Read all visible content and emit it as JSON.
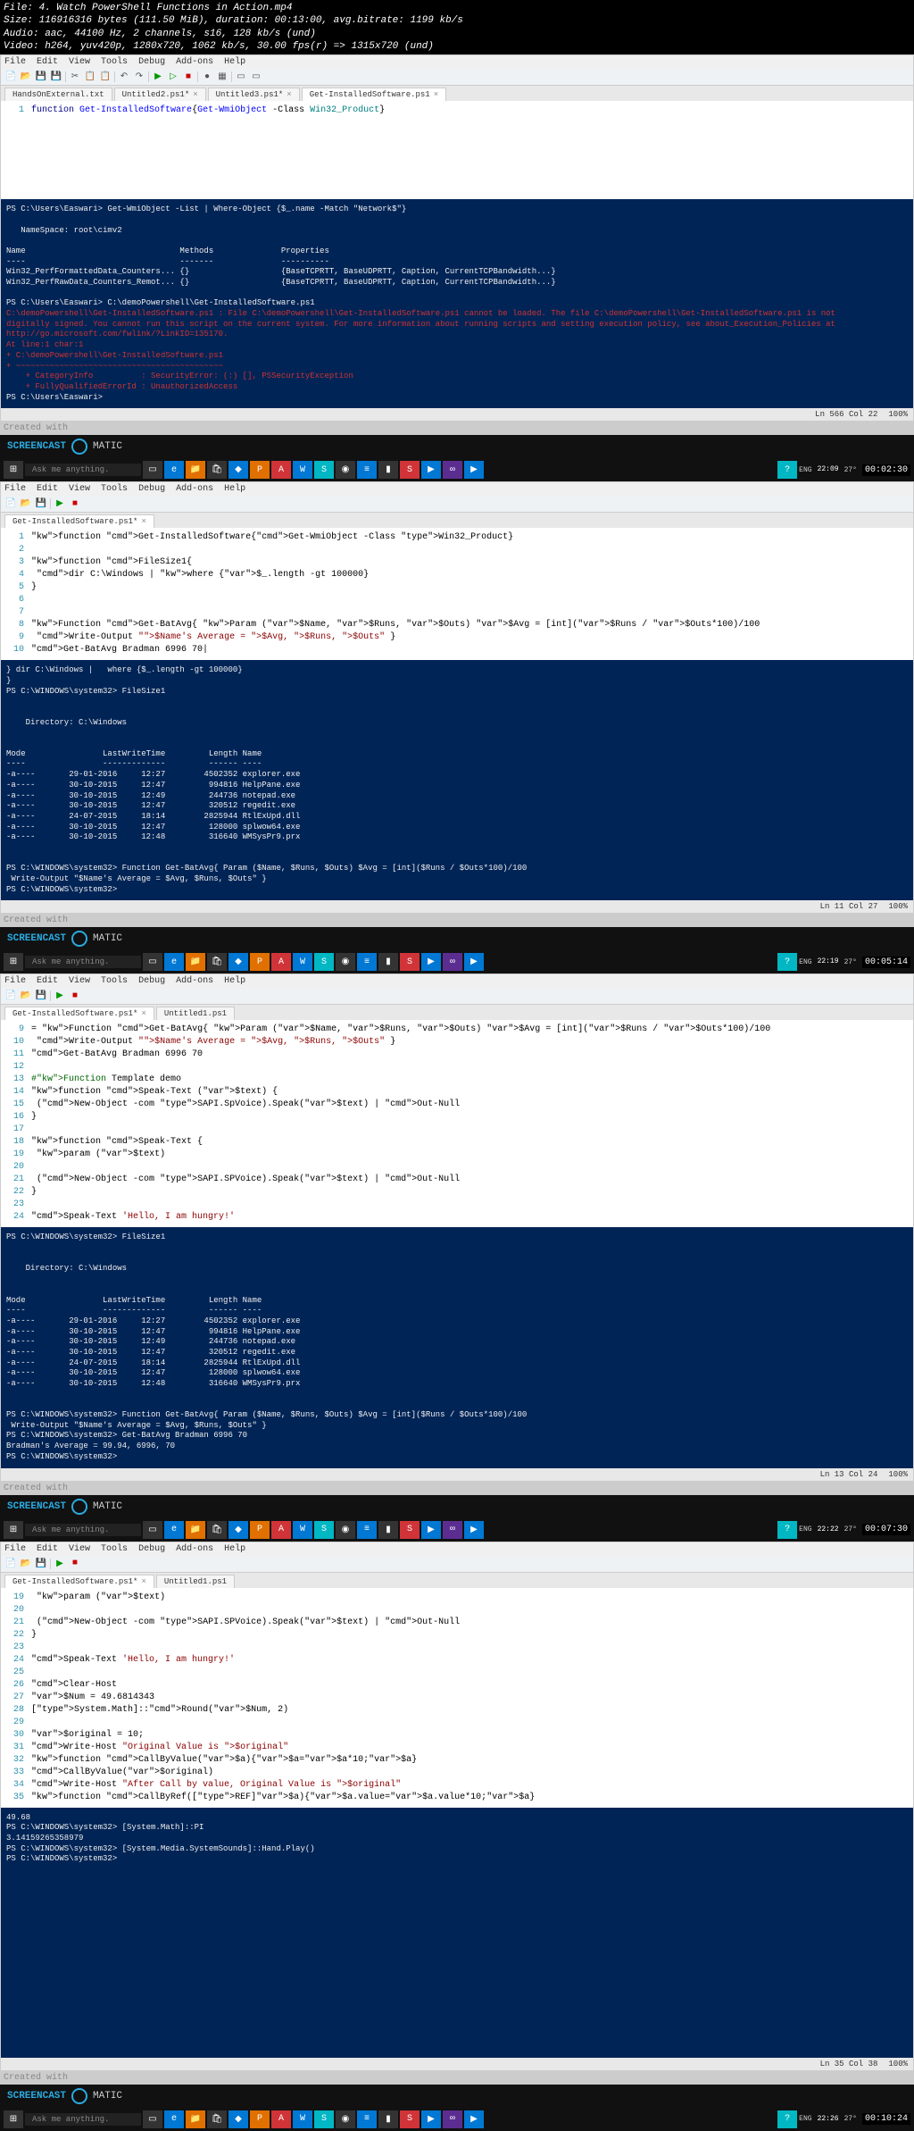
{
  "file_info": {
    "line1": "File: 4. Watch PowerShell Functions in Action.mp4",
    "line2": "Size: 116916316 bytes (111.50 MiB), duration: 00:13:00, avg.bitrate: 1199 kb/s",
    "line3": "Audio: aac, 44100 Hz, 2 channels, s16, 128 kb/s (und)",
    "line4": "Video: h264, yuv420p, 1280x720, 1062 kb/s, 30.00 fps(r) => 1315x720 (und)"
  },
  "menu": {
    "file": "File",
    "edit": "Edit",
    "view": "View",
    "tools": "Tools",
    "debug": "Debug",
    "addons": "Add-ons",
    "help": "Help"
  },
  "shot1": {
    "tabs": [
      "HandsOnExternal.txt",
      "Untitled2.ps1*",
      "Untitled3.ps1*",
      "Get-InstalledSoftware.ps1"
    ],
    "editor_line": "function Get-InstalledSoftware{Get-WmiObject -Class Win32_Product}",
    "console": "PS C:\\Users\\Easwari> Get-WmiObject -List | Where-Object {$_.name -Match \"Network$\"}\n\n   NameSpace: root\\cimv2\n\nName                                Methods              Properties\n----                                -------              ----------\nWin32_PerfFormattedData_Counters... {}                   {BaseTCPRTT, BaseUDPRTT, Caption, CurrentTCPBandwidth...}\nWin32_PerfRawData_Counters_Remot... {}                   {BaseTCPRTT, BaseUDPRTT, Caption, CurrentTCPBandwidth...}\n\nPS C:\\Users\\Easwari> C:\\demoPowershell\\Get-InstalledSoftware.ps1",
    "console_err": "C:\\demoPowershell\\Get-InstalledSoftware.ps1 : File C:\\demoPowershell\\Get-InstalledSoftware.ps1 cannot be loaded. The file C:\\demoPowershell\\Get-InstalledSoftware.ps1 is not\ndigitally signed. You cannot run this script on the current system. For more information about running scripts and setting execution policy, see about_Execution_Policies at\nhttp://go.microsoft.com/fwlink/?LinkID=135170.\nAt line:1 char:1\n+ C:\\demoPowershell\\Get-InstalledSoftware.ps1\n+ ~~~~~~~~~~~~~~~~~~~~~~~~~~~~~~~~~~~~~~~~~~~\n    + CategoryInfo          : SecurityError: (:) [], PSSecurityException\n    + FullyQualifiedErrorId : UnauthorizedAccess",
    "console_after": "PS C:\\Users\\Easwari>",
    "status": {
      "lncol": "Ln 566  Col 22",
      "zoom": "100%"
    },
    "clock": "22:09",
    "timestamp": "00:02:30"
  },
  "shot2": {
    "tabs": [
      "Get-InstalledSoftware.ps1*"
    ],
    "editor_lines": [
      "function Get-InstalledSoftware{Get-WmiObject -Class Win32_Product}",
      "",
      "function FileSize1{",
      "  dir C:\\Windows |   where {$_.length -gt 100000}",
      "}",
      "",
      "",
      "Function Get-BatAvg{ Param ($Name, $Runs, $Outs) $Avg = [int]($Runs / $Outs*100)/100",
      " Write-Output \"$Name's Average = $Avg, $Runs, $Outs\" }",
      "Get-BatAvg Bradman 6996 70|"
    ],
    "console": "} dir C:\\Windows |   where {$_.length -gt 100000}\n}\nPS C:\\WINDOWS\\system32> FileSize1\n\n\n    Directory: C:\\Windows\n\n\nMode                LastWriteTime         Length Name\n----                -------------         ------ ----\n-a----       29-01-2016     12:27        4502352 explorer.exe\n-a----       30-10-2015     12:47         994816 HelpPane.exe\n-a----       30-10-2015     12:49         244736 notepad.exe\n-a----       30-10-2015     12:47         320512 regedit.exe\n-a----       24-07-2015     18:14        2825944 RtlExUpd.dll\n-a----       30-10-2015     12:47         128000 splwow64.exe\n-a----       30-10-2015     12:48         316640 WMSysPr9.prx\n\n\nPS C:\\WINDOWS\\system32> Function Get-BatAvg{ Param ($Name, $Runs, $Outs) $Avg = [int]($Runs / $Outs*100)/100\n Write-Output \"$Name's Average = $Avg, $Runs, $Outs\" }\nPS C:\\WINDOWS\\system32>",
    "status": {
      "lncol": "Ln 11  Col 27",
      "zoom": "100%"
    },
    "clock": "22:19",
    "timestamp": "00:05:14"
  },
  "shot3": {
    "tabs": [
      "Get-InstalledSoftware.ps1*",
      "Untitled1.ps1"
    ],
    "editor_lines": [
      "= Function Get-BatAvg{ Param ($Name, $Runs, $Outs) $Avg = [int]($Runs / $Outs*100)/100",
      " Write-Output \"$Name's Average = $Avg, $Runs, $Outs\" }",
      "Get-BatAvg Bradman 6996 70",
      "",
      "#Function Template demo",
      "function Speak-Text ($text) {",
      "  (New-Object -com SAPI.SpVoice).Speak($text) | Out-Null",
      "}",
      "",
      "function Speak-Text {",
      "  param ($text)",
      "",
      "  (New-Object -com SAPI.SPVoice).Speak($text) | Out-Null",
      "}",
      "",
      "Speak-Text 'Hello, I am hungry!'"
    ],
    "editor_start_line": 9,
    "console": "PS C:\\WINDOWS\\system32> FileSize1\n\n\n    Directory: C:\\Windows\n\n\nMode                LastWriteTime         Length Name\n----                -------------         ------ ----\n-a----       29-01-2016     12:27        4502352 explorer.exe\n-a----       30-10-2015     12:47         994816 HelpPane.exe\n-a----       30-10-2015     12:49         244736 notepad.exe\n-a----       30-10-2015     12:47         320512 regedit.exe\n-a----       24-07-2015     18:14        2825944 RtlExUpd.dll\n-a----       30-10-2015     12:47         128000 splwow64.exe\n-a----       30-10-2015     12:48         316640 WMSysPr9.prx\n\n\nPS C:\\WINDOWS\\system32> Function Get-BatAvg{ Param ($Name, $Runs, $Outs) $Avg = [int]($Runs / $Outs*100)/100\n Write-Output \"$Name's Average = $Avg, $Runs, $Outs\" }\nPS C:\\WINDOWS\\system32> Get-BatAvg Bradman 6996 70\nBradman's Average = 99.94, 6996, 70\nPS C:\\WINDOWS\\system32>",
    "status": {
      "lncol": "Ln 13  Col 24",
      "zoom": "100%"
    },
    "clock": "22:22",
    "timestamp": "00:07:30"
  },
  "shot4": {
    "tabs": [
      "Get-InstalledSoftware.ps1*",
      "Untitled1.ps1"
    ],
    "editor_lines_numbered": [
      [
        19,
        "  param ($text)"
      ],
      [
        20,
        ""
      ],
      [
        21,
        "  (New-Object -com SAPI.SPVoice).Speak($text) | Out-Null"
      ],
      [
        22,
        "}"
      ],
      [
        23,
        ""
      ],
      [
        24,
        "Speak-Text 'Hello, I am hungry!'"
      ],
      [
        25,
        ""
      ],
      [
        26,
        "Clear-Host"
      ],
      [
        27,
        "$Num = 49.6814343"
      ],
      [
        28,
        "[System.Math]::Round($Num, 2)"
      ],
      [
        29,
        ""
      ],
      [
        30,
        "$original = 10;"
      ],
      [
        31,
        "Write-Host \"Original Value is $original\""
      ],
      [
        32,
        "function CallByValue($a){$a=$a*10;$a}"
      ],
      [
        33,
        "CallByValue($original)"
      ],
      [
        34,
        "Write-Host \"After Call by value, Original Value is $original\""
      ],
      [
        35,
        "function CallByRef([REF]$a){$a.value=$a.value*10;$a}"
      ]
    ],
    "console": "49.68\nPS C:\\WINDOWS\\system32> [System.Math]::PI\n3.14159265358979\nPS C:\\WINDOWS\\system32> [System.Media.SystemSounds]::Hand.Play()\nPS C:\\WINDOWS\\system32>",
    "status": {
      "lncol": "Ln 35  Col 38",
      "zoom": "100%"
    },
    "clock": "22:26",
    "timestamp": "00:10:24"
  },
  "watermark": "Created with",
  "screencast": {
    "brand": "SCREENCAST",
    "suffix": "MATIC",
    "search": "Ask me anything."
  },
  "tray": {
    "lang": "ENG",
    "temp": "27°"
  }
}
